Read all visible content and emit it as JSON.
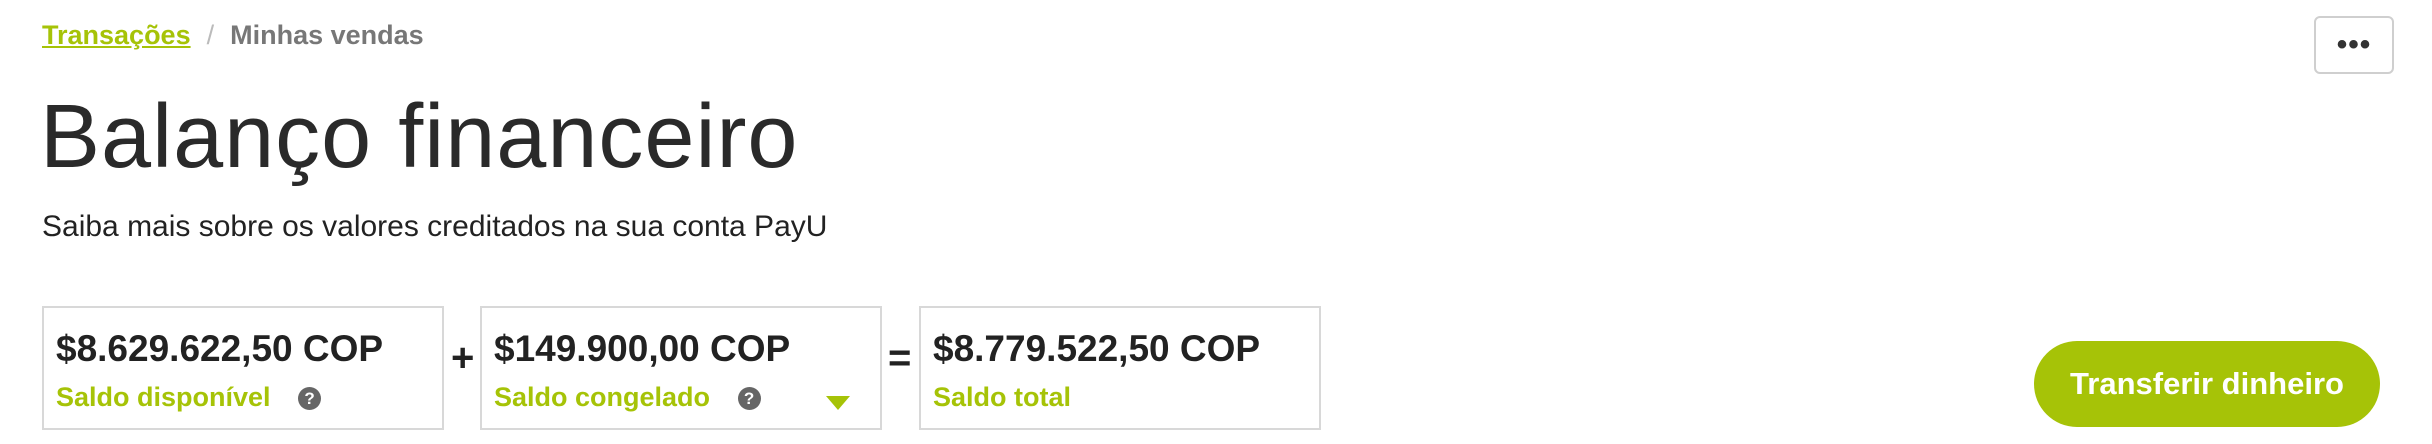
{
  "breadcrumb": {
    "parent": "Transações",
    "separator": "/",
    "current": "Minhas vendas"
  },
  "header": {
    "more_label": "•••",
    "title": "Balanço financeiro",
    "subtitle": "Saiba mais sobre os valores creditados na sua conta PayU"
  },
  "balances": {
    "available": {
      "amount": "$8.629.622,50 COP",
      "label": "Saldo disponível",
      "help": "?"
    },
    "plus": "+",
    "frozen": {
      "amount": "$149.900,00 COP",
      "label": "Saldo congelado",
      "help": "?"
    },
    "equals": "=",
    "total": {
      "amount": "$8.779.522,50 COP",
      "label": "Saldo total"
    }
  },
  "actions": {
    "transfer_label": "Transferir dinheiro"
  },
  "colors": {
    "accent": "#a6c307",
    "text": "#222222",
    "muted": "#777777",
    "border": "#d8d8d8"
  }
}
